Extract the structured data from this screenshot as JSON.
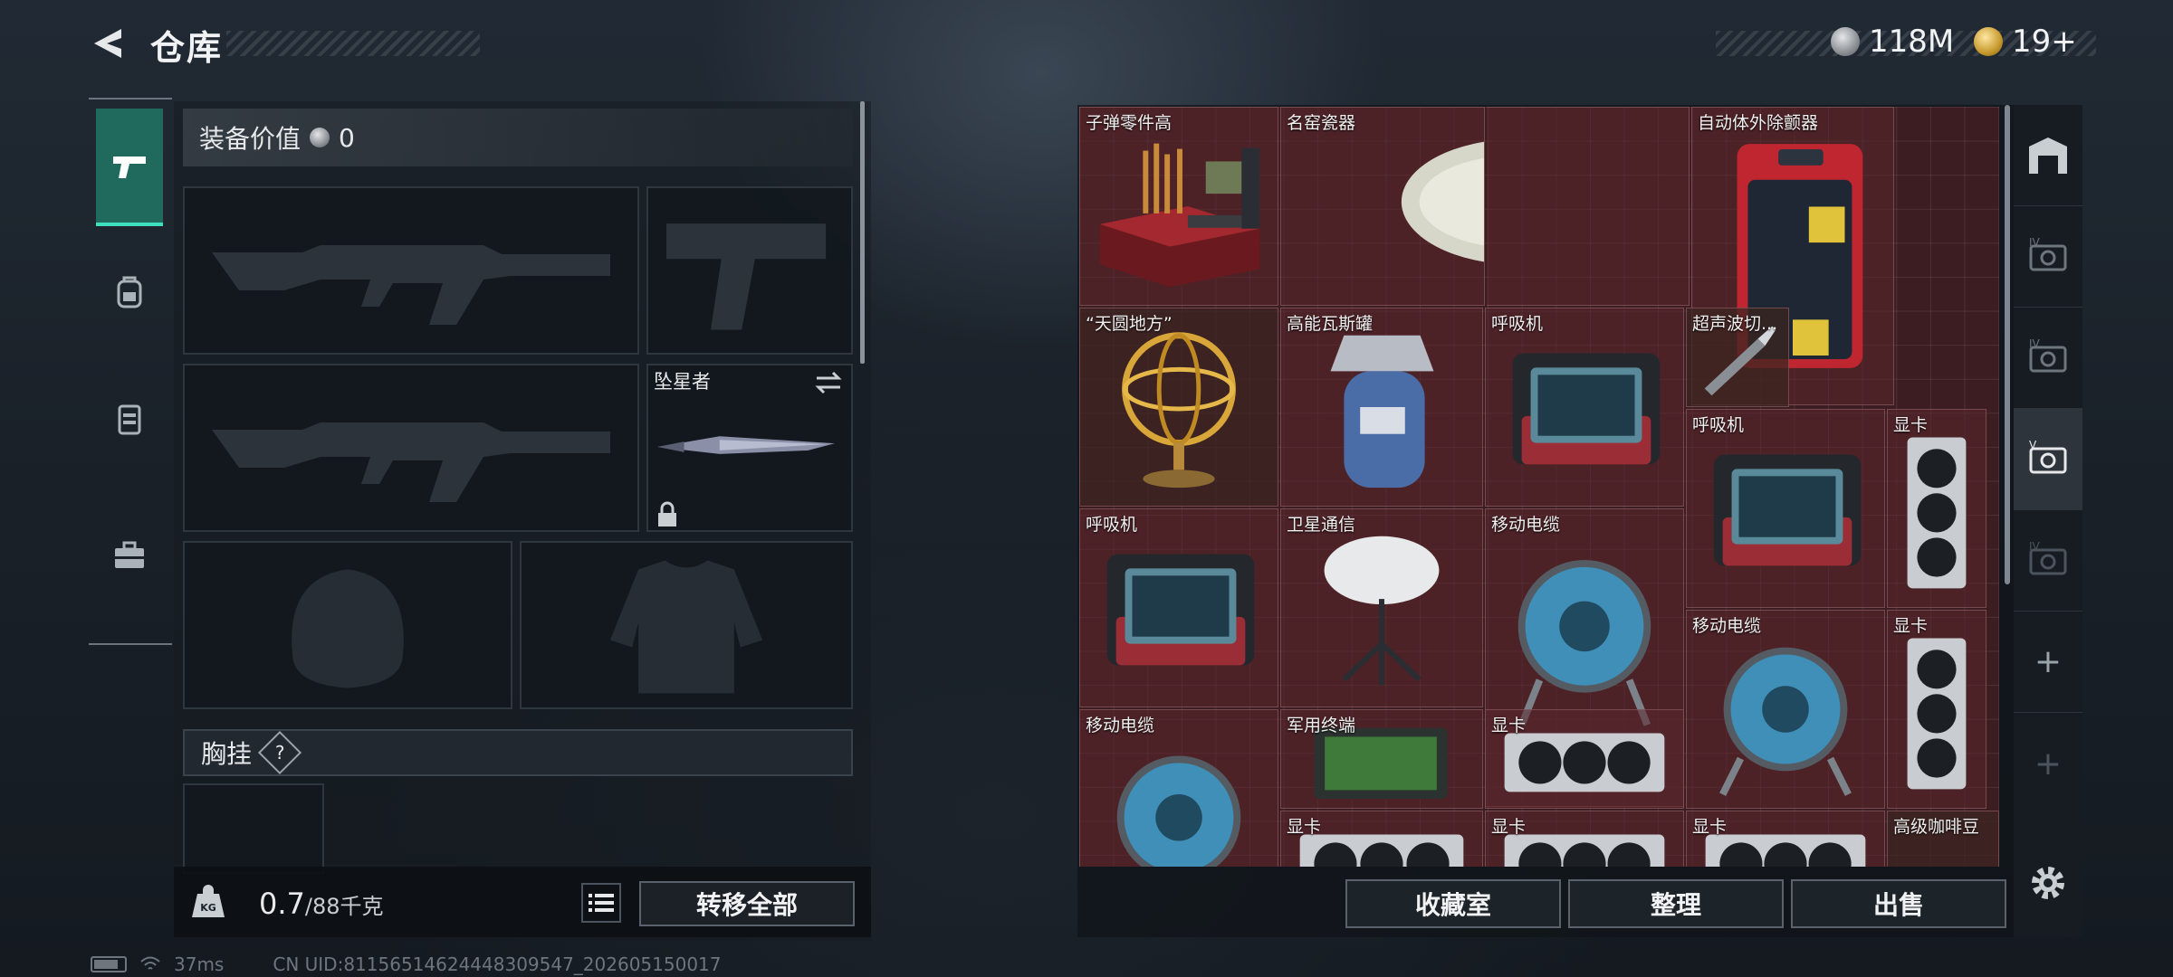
{
  "header": {
    "title": "仓库"
  },
  "currencies": [
    {
      "icon": "silver-coin-icon",
      "value": "118M"
    },
    {
      "icon": "gold-coin-icon",
      "value": "19+"
    }
  ],
  "rail": {
    "items": [
      {
        "name": "weapons-tab",
        "icon": "pistol-icon",
        "active": true
      },
      {
        "name": "backpack-tab",
        "icon": "backpack-icon",
        "active": false
      },
      {
        "name": "armor-tab",
        "icon": "vest-icon",
        "active": false
      },
      {
        "name": "toolbox-tab",
        "icon": "toolbox-icon",
        "active": false
      }
    ]
  },
  "equipment": {
    "value_label": "装备价值",
    "value_amount": "0",
    "melee_slot_label": "坠星者",
    "chest_rig_label": "胸挂",
    "chest_rig_help": "?",
    "weight_current": "0.7",
    "weight_max": "/88千克",
    "transfer_all_label": "转移全部",
    "weight_icon_text": "KG"
  },
  "storage": {
    "items": [
      {
        "id": "ammo-parts",
        "label": "子弹零件高"
      },
      {
        "id": "porcelain",
        "label": "名窑瓷器"
      },
      {
        "id": "aed",
        "label": "自动体外除颤器"
      },
      {
        "id": "armillary",
        "label": "“天圆地方”"
      },
      {
        "id": "gas-tank",
        "label": "高能瓦斯罐"
      },
      {
        "id": "ventilator-1",
        "label": "呼吸机"
      },
      {
        "id": "ultrasonic",
        "label": "超声波切..."
      },
      {
        "id": "ventilator-2",
        "label": "呼吸机"
      },
      {
        "id": "gpu-1",
        "label": "显卡"
      },
      {
        "id": "ventilator-3",
        "label": "呼吸机"
      },
      {
        "id": "satellite",
        "label": "卫星通信"
      },
      {
        "id": "cable-1",
        "label": "移动电缆"
      },
      {
        "id": "cable-2",
        "label": "移动电缆"
      },
      {
        "id": "gpu-2",
        "label": "显卡"
      },
      {
        "id": "cable-3",
        "label": "移动电缆"
      },
      {
        "id": "terminal",
        "label": "军用终端"
      },
      {
        "id": "gpu-3",
        "label": "显卡"
      },
      {
        "id": "gpu-4",
        "label": "显卡"
      },
      {
        "id": "gpu-5",
        "label": "显卡"
      },
      {
        "id": "gpu-6",
        "label": "显卡"
      },
      {
        "id": "coffee",
        "label": "高级咖啡豆"
      }
    ],
    "buttons": {
      "collection": "收藏室",
      "organize": "整理",
      "sell": "出售"
    }
  },
  "status": {
    "ping": "37ms",
    "uid": "CN UID:81156514624448309547_202605150017"
  },
  "colors": {
    "accent": "#3fe0bd",
    "grid_bg": "#3c1d22"
  }
}
